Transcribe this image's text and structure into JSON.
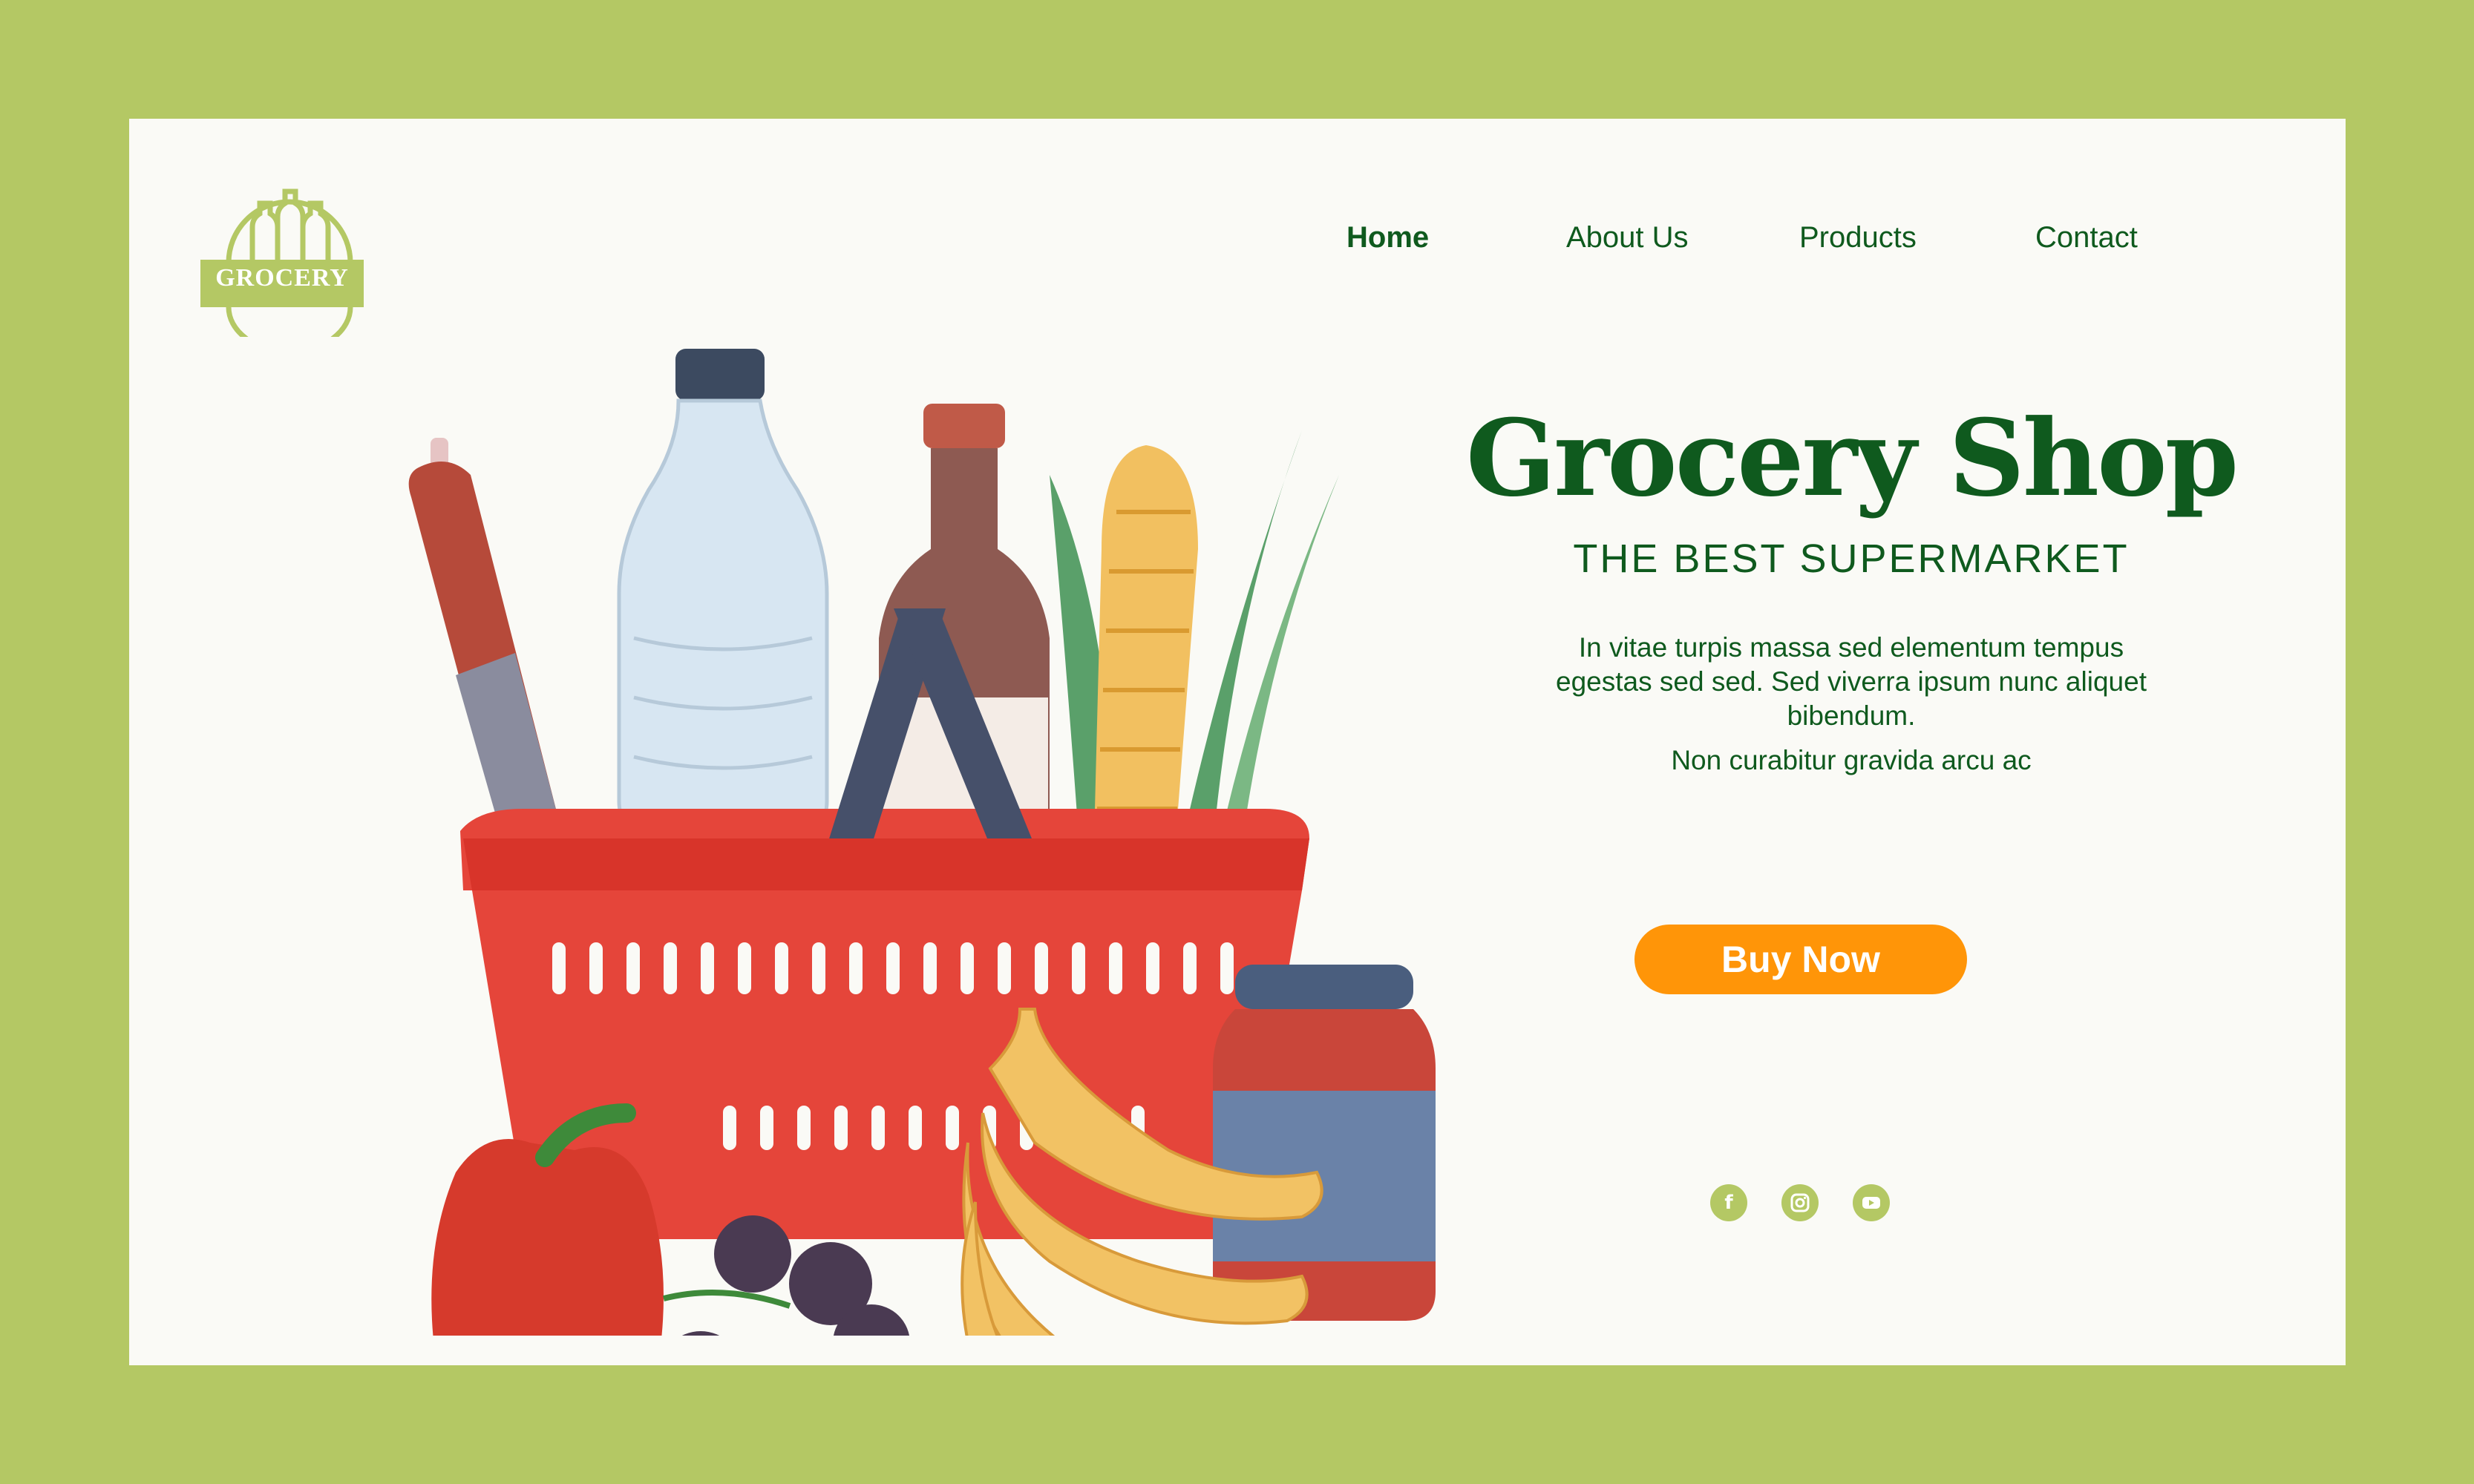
{
  "logo": {
    "text": "GROCERY",
    "color": "#b4c864"
  },
  "nav": {
    "items": [
      {
        "label": "Home",
        "active": true
      },
      {
        "label": "About Us",
        "active": false
      },
      {
        "label": "Products",
        "active": false
      },
      {
        "label": "Contact",
        "active": false
      }
    ]
  },
  "hero": {
    "title": "Grocery Shop",
    "subtitle": "THE BEST SUPERMARKET",
    "description": "In vitae turpis massa sed elementum tempus egestas sed sed. Sed viverra ipsum nunc aliquet bibendum.",
    "description2": "Non curabitur gravida arcu ac",
    "cta_label": "Buy Now"
  },
  "social": [
    {
      "icon": "facebook-icon",
      "glyph": "f"
    },
    {
      "icon": "instagram-icon"
    },
    {
      "icon": "youtube-icon"
    }
  ],
  "colors": {
    "frame": "#b4c864",
    "card": "#fafaf6",
    "primary_text": "#0f5a1e",
    "cta": "#ff9508"
  }
}
